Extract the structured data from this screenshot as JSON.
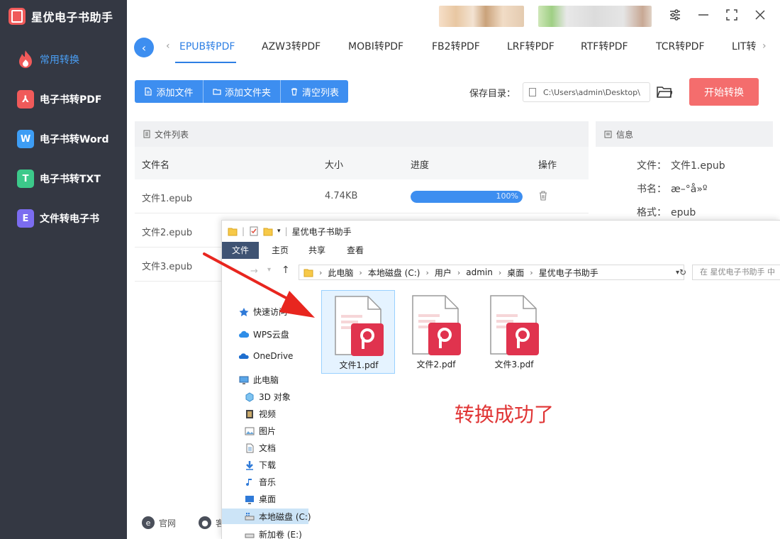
{
  "app": {
    "title": "星优电子书助手"
  },
  "sidebar": {
    "items": [
      {
        "label": "常用转换",
        "icon": "flame-icon",
        "color": "#f05a5a",
        "active": true
      },
      {
        "label": "电子书转PDF",
        "icon": "pdf-icon",
        "color": "#f05a5a",
        "glyph": "⅄"
      },
      {
        "label": "电子书转Word",
        "icon": "word-icon",
        "color": "#3d9df5",
        "glyph": "W"
      },
      {
        "label": "电子书转TXT",
        "icon": "txt-icon",
        "color": "#3cc98a",
        "glyph": "T"
      },
      {
        "label": "文件转电子书",
        "icon": "ebook-icon",
        "color": "#7b6cf0",
        "glyph": "E"
      }
    ],
    "footer": {
      "website": "官网",
      "service": "客"
    }
  },
  "tabs": [
    "EPUB转PDF",
    "AZW3转PDF",
    "MOBI转PDF",
    "FB2转PDF",
    "LRF转PDF",
    "RTF转PDF",
    "TCR转PDF",
    "LIT转"
  ],
  "toolbar": {
    "add_file": "添加文件",
    "add_folder": "添加文件夹",
    "clear_list": "清空列表"
  },
  "save": {
    "label": "保存目录：",
    "path": "C:\\Users\\admin\\Desktop\\"
  },
  "start_button": "开始转换",
  "file_list": {
    "title": "文件列表",
    "columns": {
      "name": "文件名",
      "size": "大小",
      "progress": "进度",
      "action": "操作"
    },
    "rows": [
      {
        "name": "文件1.epub",
        "size": "4.74KB",
        "progress": 1.0,
        "progress_label": "100%"
      },
      {
        "name": "文件2.epub"
      },
      {
        "name": "文件3.epub"
      }
    ]
  },
  "info": {
    "title": "信息",
    "rows": [
      {
        "key": "文件：",
        "value": "文件1.epub"
      },
      {
        "key": "书名：",
        "value": "æ–°å»º"
      },
      {
        "key": "格式：",
        "value": "epub"
      }
    ]
  },
  "explorer": {
    "title": "星优电子书助手",
    "ribbon": [
      "文件",
      "主页",
      "共享",
      "查看"
    ],
    "breadcrumb": [
      "此电脑",
      "本地磁盘 (C:)",
      "用户",
      "admin",
      "桌面",
      "星优电子书助手"
    ],
    "search_placeholder": "在 星优电子书助手 中",
    "nav": {
      "quick": "快速访问",
      "wps": "WPS云盘",
      "onedrive": "OneDrive",
      "pc": "此电脑",
      "obj3d": "3D 对象",
      "video": "视频",
      "pictures": "图片",
      "docs": "文档",
      "downloads": "下载",
      "music": "音乐",
      "desktop": "桌面",
      "disk_c": "本地磁盘 (C:)",
      "disk_e": "新加卷 (E:)"
    },
    "files": [
      "文件1.pdf",
      "文件2.pdf",
      "文件3.pdf"
    ]
  },
  "success_message": "转换成功了",
  "colors": {
    "accent": "#3d8ef0",
    "start": "#f46d6d",
    "sidebar": "#343843",
    "pdf": "#e0334e"
  }
}
